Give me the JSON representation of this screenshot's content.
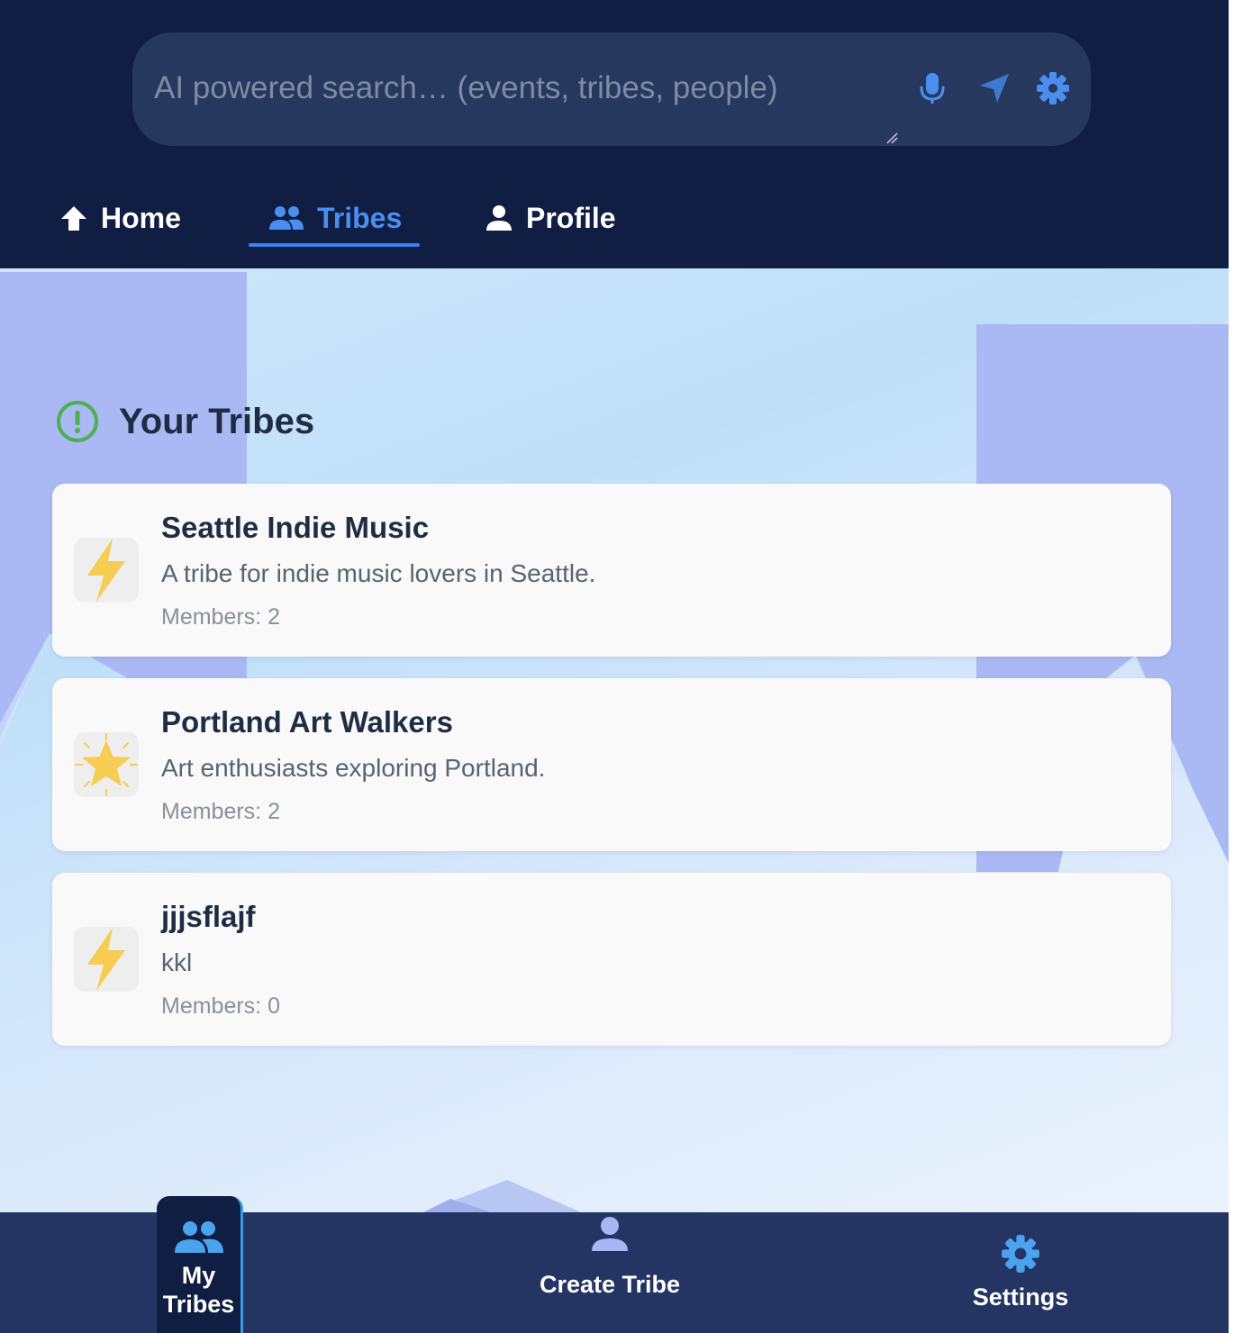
{
  "search": {
    "placeholder": "AI powered search… (events, tribes, people)",
    "icons": [
      "microphone-icon",
      "send-icon",
      "gear-icon"
    ]
  },
  "top_nav": {
    "tabs": [
      {
        "label": "Home",
        "icon": "home-icon",
        "active": false
      },
      {
        "label": "Tribes",
        "icon": "people-icon",
        "active": true
      },
      {
        "label": "Profile",
        "icon": "person-icon",
        "active": false
      }
    ]
  },
  "section": {
    "title": "Your Tribes",
    "icon": "alert-circle-icon"
  },
  "tribes": [
    {
      "name": "Seattle Indie Music",
      "description": "A tribe for indie music lovers in Seattle.",
      "members": "Members: 2",
      "icon": "lightning-icon"
    },
    {
      "name": "Portland Art Walkers",
      "description": "Art enthusiasts exploring Portland.",
      "members": "Members: 2",
      "icon": "star-icon"
    },
    {
      "name": "jjjsflajf",
      "description": "kkl",
      "members": "Members: 0",
      "icon": "lightning-icon"
    }
  ],
  "bottom_nav": {
    "items": [
      {
        "label": "My Tribes",
        "icon": "people-icon",
        "active": true
      },
      {
        "label": "Create Tribe",
        "icon": "person-icon",
        "active": false
      },
      {
        "label": "Settings",
        "icon": "gear-icon",
        "active": false
      }
    ]
  },
  "colors": {
    "header_bg": "#0f1e42",
    "search_bg": "#27385f",
    "accent": "#3b82f6",
    "bottom_nav_bg": "#253563",
    "card_bg": "#f9f9f9",
    "section_icon": "#4caf50"
  }
}
